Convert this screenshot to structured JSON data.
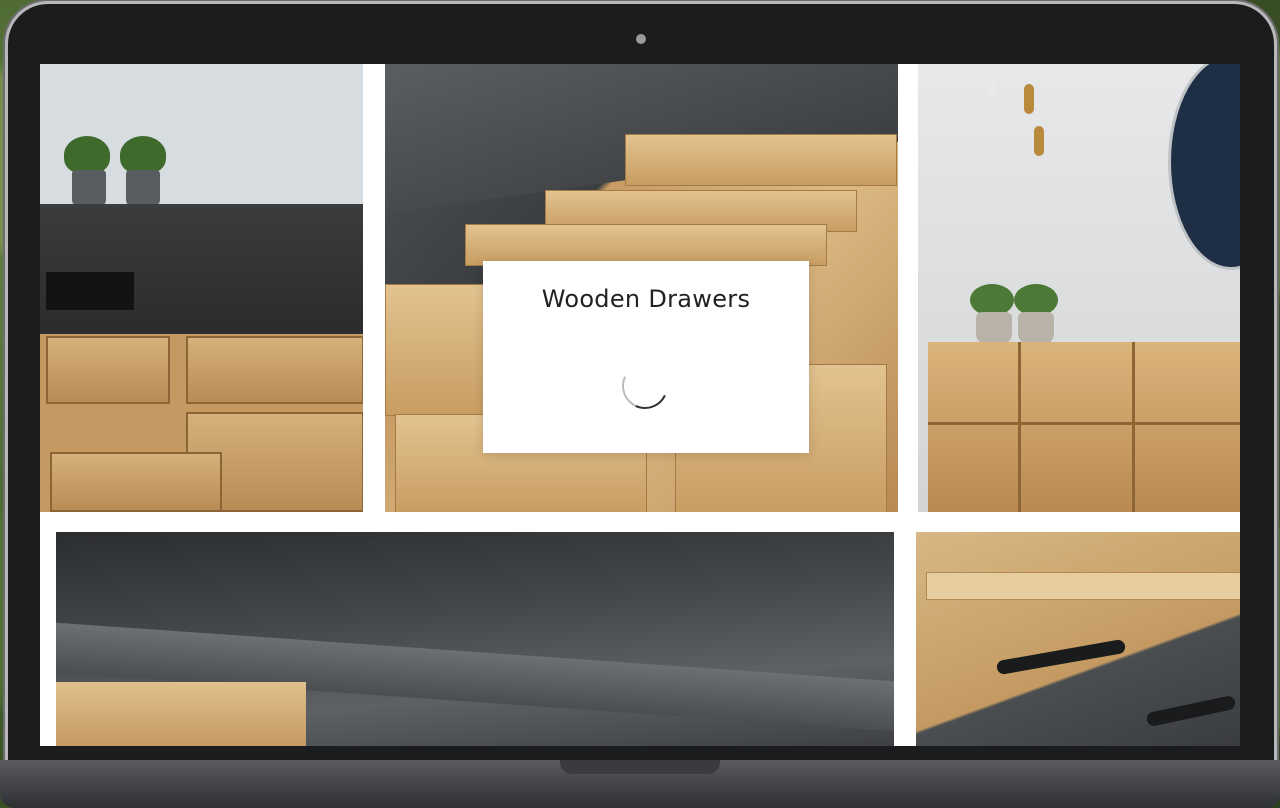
{
  "modal": {
    "title": "Wooden Drawers",
    "loading": true
  },
  "gallery": {
    "tiles": [
      {
        "name": "kitchen-drawers"
      },
      {
        "name": "open-drawer"
      },
      {
        "name": "wall-cabinet"
      },
      {
        "name": "countertop"
      },
      {
        "name": "knife-drawer"
      }
    ]
  },
  "icons": {
    "spinner": "loading-spinner-icon",
    "camera": "camera-icon"
  },
  "colors": {
    "modal_bg": "#ffffff",
    "text": "#222222",
    "laptop_frame": "#1b1c1e"
  }
}
